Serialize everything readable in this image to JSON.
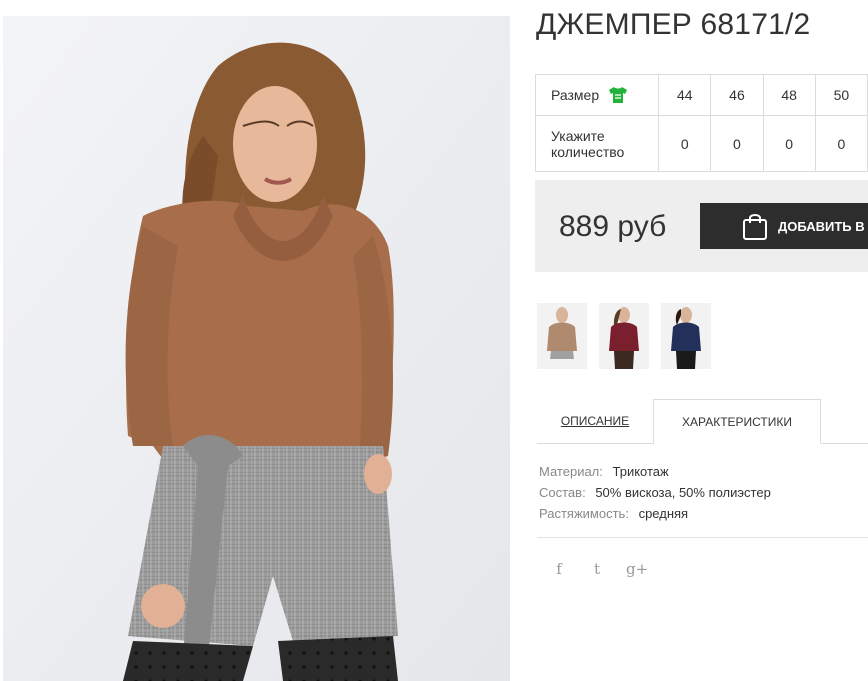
{
  "product": {
    "title": "ДЖЕМПЕР 68171/2",
    "size_label": "Размер",
    "qty_label": "Укажите количество",
    "sizes": [
      "44",
      "46",
      "48",
      "50"
    ],
    "quantities": [
      "0",
      "0",
      "0",
      "0"
    ],
    "price": "889 руб",
    "add_to_cart": "ДОБАВИТЬ В З"
  },
  "thumbnails": [
    {
      "name": "thumbnail-1",
      "color": "#b08a6e"
    },
    {
      "name": "thumbnail-2",
      "color": "#7a1f2e"
    },
    {
      "name": "thumbnail-3",
      "color": "#22305a"
    }
  ],
  "tabs": {
    "description": "ОПИСАНИЕ",
    "characteristics": "ХАРАКТЕРИСТИКИ"
  },
  "specs": [
    {
      "key": "Материал:",
      "value": "Трикотаж"
    },
    {
      "key": "Состав:",
      "value": "50% вискоза, 50% полиэстер"
    },
    {
      "key": "Растяжимость:",
      "value": "средняя"
    }
  ],
  "social": {
    "facebook": "f",
    "twitter": "t",
    "google_plus": "g+"
  },
  "icons": {
    "size_chart": "shirt-icon",
    "cart": "shopping-bag-icon"
  },
  "colors": {
    "size_icon": "#22b33a",
    "button_bg": "#2d2d2d",
    "price_bg": "#eeeeee"
  }
}
